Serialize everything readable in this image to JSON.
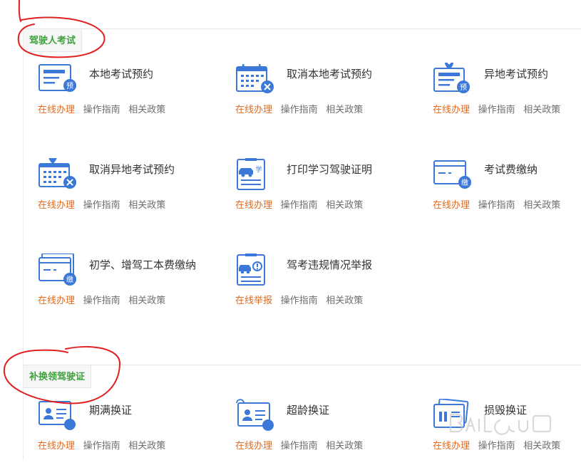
{
  "colors": {
    "accent_green": "#3f9f3f",
    "primary_link": "#e16a1e",
    "secondary_link": "#6e6e6e",
    "icon_blue": "#3c78d8",
    "annotation_red": "#e02020"
  },
  "sections": [
    {
      "label": "驾驶人考试",
      "items": [
        {
          "title": "本地考试预约",
          "icon": "form-icon",
          "badge": "预",
          "links": [
            "在线办理",
            "操作指南",
            "相关政策"
          ]
        },
        {
          "title": "取消本地考试预约",
          "icon": "calendar-cancel-icon",
          "badge": "",
          "links": [
            "在线办理",
            "操作指南",
            "相关政策"
          ]
        },
        {
          "title": "异地考试预约",
          "icon": "location-form-icon",
          "badge": "预",
          "links": [
            "在线办理",
            "操作指南",
            "相关政策"
          ]
        },
        {
          "title": "取消异地考试预约",
          "icon": "location-calendar-cancel-icon",
          "badge": "",
          "links": [
            "在线办理",
            "操作指南",
            "相关政策"
          ]
        },
        {
          "title": "打印学习驾驶证明",
          "icon": "clipboard-car-icon",
          "badge": "学",
          "links": [
            "在线办理",
            "操作指南",
            "相关政策"
          ]
        },
        {
          "title": "考试费缴纳",
          "icon": "card-payment-icon",
          "badge": "缴",
          "links": [
            "在线办理",
            "操作指南",
            "相关政策"
          ]
        },
        {
          "title": "初学、增驾工本费缴纳",
          "icon": "cards-payment-icon",
          "badge": "缴",
          "links": [
            "在线办理",
            "操作指南",
            "相关政策"
          ]
        },
        {
          "title": "驾考违规情况举报",
          "icon": "clipboard-alert-icon",
          "badge": "",
          "links": [
            "在线举报",
            "操作指南",
            "相关政策"
          ]
        }
      ]
    },
    {
      "label": "补换领驾驶证",
      "items": [
        {
          "title": "期满换证",
          "icon": "id-card-icon",
          "badge": "",
          "links": [
            "在线办理",
            "操作指南",
            "相关政策"
          ]
        },
        {
          "title": "超龄换证",
          "icon": "id-card-renew-icon",
          "badge": "",
          "links": [
            "在线办理",
            "操作指南",
            "相关政策"
          ]
        },
        {
          "title": "损毁换证",
          "icon": "damaged-card-icon",
          "badge": "",
          "links": [
            "在线办理",
            "操作指南",
            "相关政策"
          ]
        }
      ]
    }
  ]
}
